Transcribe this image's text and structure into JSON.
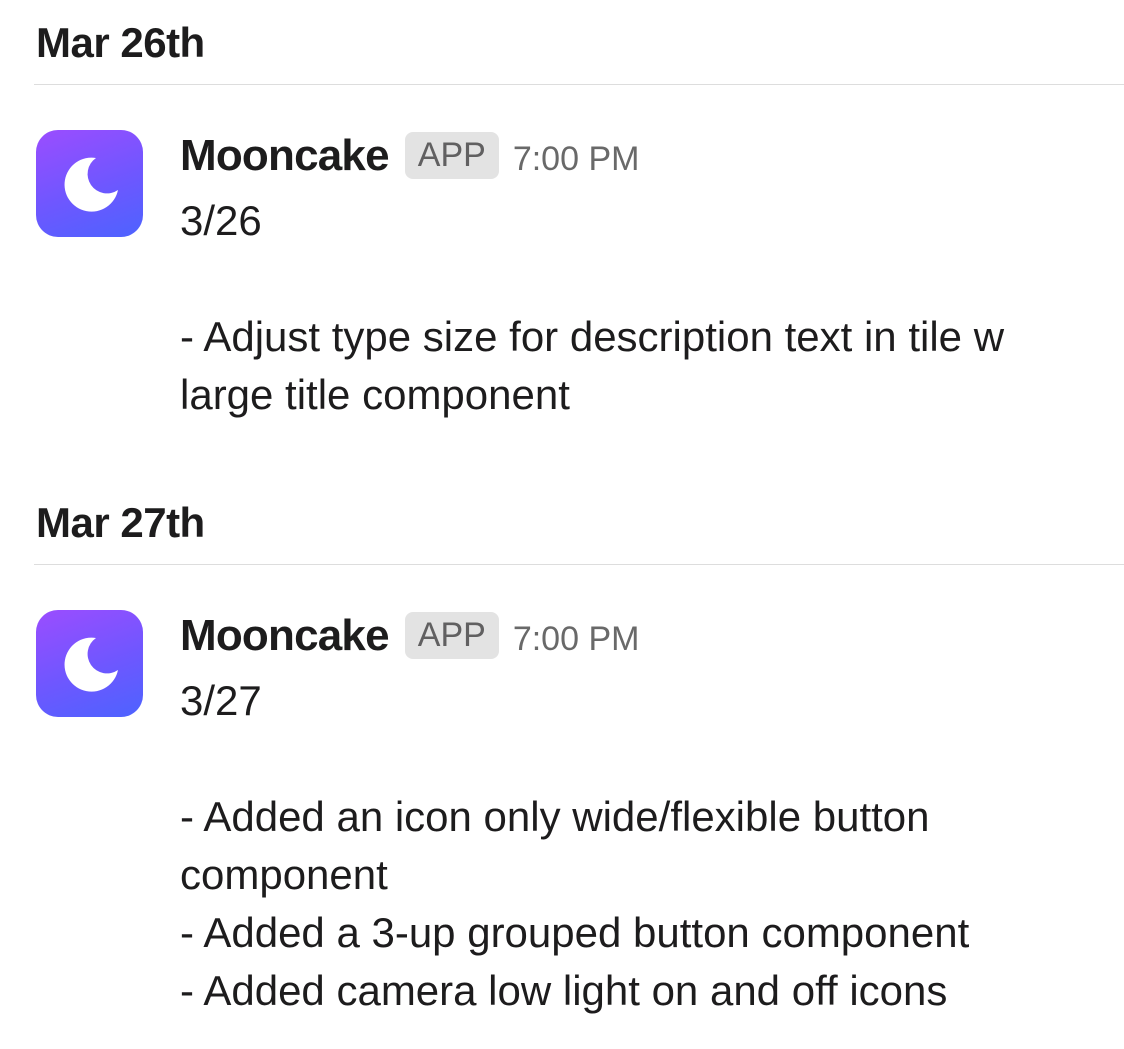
{
  "days": [
    {
      "date_label": "Mar 26th",
      "message": {
        "sender": "Mooncake",
        "badge": "APP",
        "time": "7:00 PM",
        "avatar_icon": "crescent-moon-icon",
        "lines": [
          "3/26",
          "",
          "- Adjust type size for description text in tile w large title component"
        ]
      }
    },
    {
      "date_label": "Mar 27th",
      "message": {
        "sender": "Mooncake",
        "badge": "APP",
        "time": "7:00 PM",
        "avatar_icon": "crescent-moon-icon",
        "lines": [
          "3/27",
          "",
          "- Added an icon only wide/flexible button component",
          "- Added a 3-up grouped button component",
          "- Added camera low light on and off icons"
        ]
      }
    }
  ],
  "colors": {
    "avatar_gradient_top": "#9b4dff",
    "avatar_gradient_bottom": "#4d63ff",
    "badge_bg": "#e3e3e3",
    "divider": "#dddddd"
  }
}
